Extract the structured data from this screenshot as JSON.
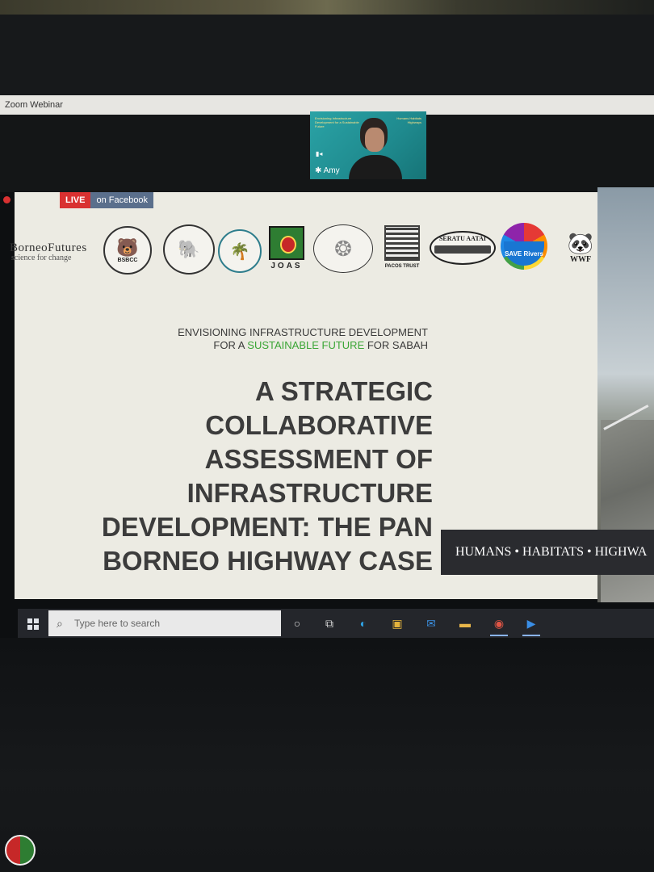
{
  "window": {
    "title": "Zoom Webinar"
  },
  "video": {
    "participant_name": "Amy",
    "slide_text_left": "Envisioning Infrastructure Development for a Sustainable Future",
    "slide_text_right": "Humans Habitats Highways"
  },
  "stream": {
    "live_label": "LIVE",
    "platform_label": "on Facebook"
  },
  "logos": {
    "borneo_big": "BorneoFutures",
    "borneo_small": "science for change",
    "bsbcc": "BSBCC",
    "joas": "JOAS",
    "pacos": "PACOS TRUST",
    "seratu": "SERATU AATAI",
    "save": "SAVE Rivers",
    "wwf": "WWF"
  },
  "slide": {
    "subtitle_line1": "ENVISIONING INFRASTRUCTURE DEVELOPMENT",
    "subtitle_line2_pre": "FOR A ",
    "subtitle_line2_green": "SUSTAINABLE FUTURE",
    "subtitle_line2_post": " FOR SABAH",
    "title_lines": [
      "A STRATEGIC",
      "COLLABORATIVE",
      "ASSESSMENT OF",
      "INFRASTRUCTURE",
      "DEVELOPMENT: THE PAN",
      "BORNEO HIGHWAY CASE"
    ],
    "banner": "HUMANS • HABITATS • HIGHWA"
  },
  "taskbar": {
    "search_placeholder": "Type here to search"
  },
  "colors": {
    "live_red": "#d93131",
    "green_accent": "#3aa535",
    "taskbar": "#24262b"
  }
}
